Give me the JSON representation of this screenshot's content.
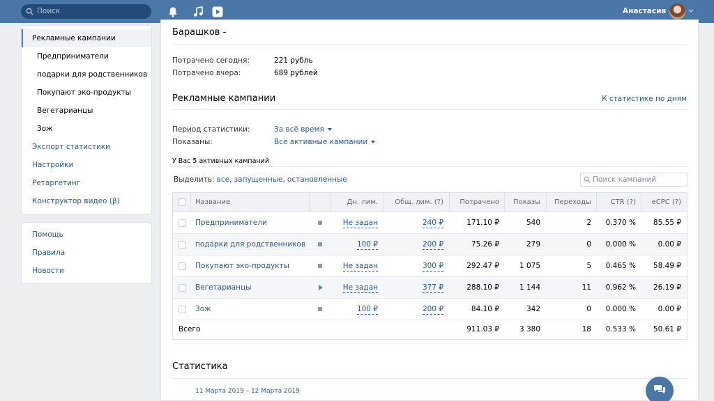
{
  "header": {
    "search_placeholder": "Поиск",
    "user_name": "Анастасия"
  },
  "sidebar": {
    "items": [
      {
        "label": "Рекламные кампании"
      },
      {
        "label": "Предприниматели"
      },
      {
        "label": "подарки для родственников"
      },
      {
        "label": "Покупают эко-продукты"
      },
      {
        "label": "Вегетарианцы"
      },
      {
        "label": "Зож"
      },
      {
        "label": "Экспорт статистики"
      },
      {
        "label": "Настройки"
      },
      {
        "label": "Ретаргетинг"
      },
      {
        "label": "Конструктор видео (β)"
      }
    ],
    "secondary": [
      {
        "label": "Помощь"
      },
      {
        "label": "Правила"
      },
      {
        "label": "Новости"
      }
    ]
  },
  "main": {
    "account_title": "Барашков -",
    "spent_today_label": "Потрачено сегодня:",
    "spent_today_value": "221 рубль",
    "spent_yesterday_label": "Потрачено вчера:",
    "spent_yesterday_value": "689 рублей",
    "campaigns_title": "Рекламные кампании",
    "daily_stats_link": "К статистике по дням",
    "period_label": "Период статистики:",
    "period_value": "За всё время",
    "shown_label": "Показаны:",
    "shown_value": "Все активные кампании",
    "active_count_text": "У Вас 5 активных кампаний",
    "select_label": "Выделить:",
    "select_all": "все",
    "select_running": "запущенные",
    "select_stopped": "остановленные",
    "comma": ",",
    "search_placeholder": "Поиск кампаний",
    "stats_title": "Статистика",
    "date_range": "11 Марта 2019 – 12 Марта 2019"
  },
  "table": {
    "headers": {
      "name": "Название",
      "daily": "Дн. лим.",
      "total": "Общ. лим. (?)",
      "spent": "Потрачено",
      "impressions": "Показы",
      "clicks": "Переходы",
      "ctr": "CTR (?)",
      "ecpc": "eCPC (?)"
    },
    "rows": [
      {
        "name": "Предприниматели",
        "status": "stopped",
        "daily": "Не задан",
        "total": "240 ₽",
        "spent": "171.10 ₽",
        "impressions": "540",
        "clicks": "2",
        "ctr": "0.370 %",
        "ecpc": "85.55 ₽"
      },
      {
        "name": "подарки для родственников",
        "status": "stopped",
        "daily": "100 ₽",
        "total": "200 ₽",
        "spent": "75.26 ₽",
        "impressions": "279",
        "clicks": "0",
        "ctr": "0.000 %",
        "ecpc": "0.00 ₽"
      },
      {
        "name": "Покупают эко-продукты",
        "status": "stopped",
        "daily": "Не задан",
        "total": "300 ₽",
        "spent": "292.47 ₽",
        "impressions": "1 075",
        "clicks": "5",
        "ctr": "0.465 %",
        "ecpc": "58.49 ₽"
      },
      {
        "name": "Вегетарианцы",
        "status": "running",
        "daily": "Не задан",
        "total": "377 ₽",
        "spent": "288.10 ₽",
        "impressions": "1 144",
        "clicks": "11",
        "ctr": "0.962 %",
        "ecpc": "26.19 ₽"
      },
      {
        "name": "Зож",
        "status": "stopped",
        "daily": "100 ₽",
        "total": "200 ₽",
        "spent": "84.10 ₽",
        "impressions": "342",
        "clicks": "0",
        "ctr": "0.000 %",
        "ecpc": "0.00 ₽"
      }
    ],
    "total": {
      "label": "Всего",
      "spent": "911.03 ₽",
      "impressions": "3 380",
      "clicks": "18",
      "ctr": "0.533 %",
      "ecpc": "50.61 ₽"
    }
  },
  "colors": {
    "accent": "#4a76a8",
    "link": "#2a5885"
  }
}
